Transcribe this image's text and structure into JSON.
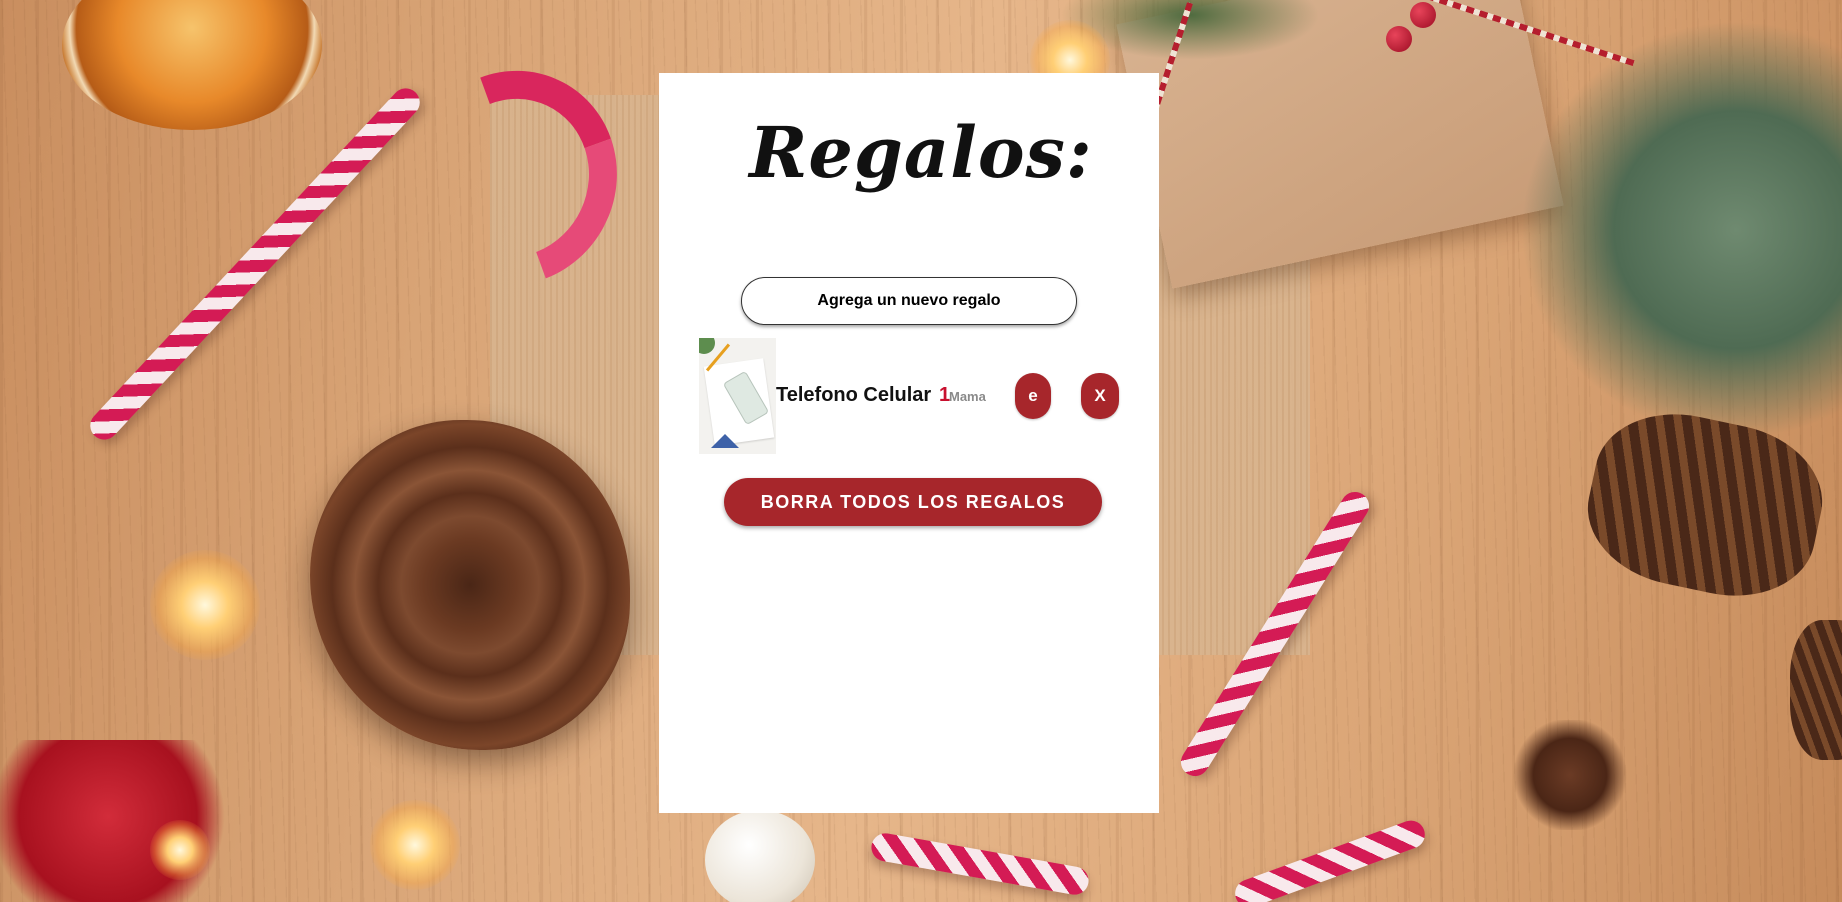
{
  "page": {
    "title": "Regalos:"
  },
  "actions": {
    "add_label": "Agrega un nuevo regalo",
    "clear_all_label": "BORRA TODOS LOS REGALOS"
  },
  "gifts": [
    {
      "name": "Telefono Celular",
      "quantity": "1",
      "recipient": "Mama",
      "edit_label": "e",
      "delete_label": "X",
      "image_icon": "phone-on-desk-thumbnail"
    }
  ],
  "colors": {
    "accent": "#a7262b",
    "quantity": "#c8102e",
    "recipient": "#8a8a8a",
    "card": "#ffffff"
  }
}
